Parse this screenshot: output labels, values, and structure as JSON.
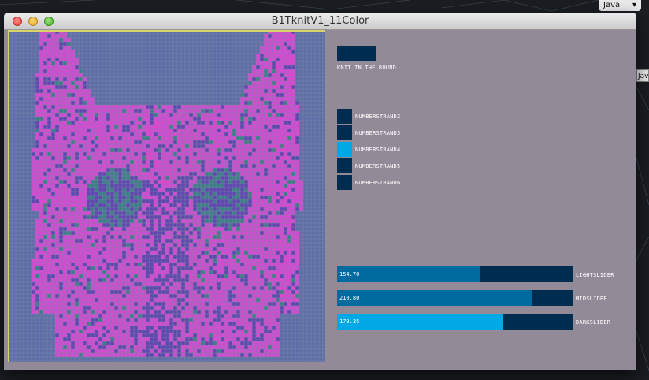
{
  "window": {
    "title": "B1TknitV1_11Color"
  },
  "external": {
    "java_label": "Java",
    "java_label2": "Jav"
  },
  "toggle": {
    "label": "KNIT IN THE ROUND"
  },
  "strands": [
    {
      "label": "NUMBERSTRAND2",
      "active": false
    },
    {
      "label": "NUMBERSTRAND3",
      "active": false
    },
    {
      "label": "NUMBERSTRAND4",
      "active": true
    },
    {
      "label": "NUMBERSTRAND5",
      "active": false
    },
    {
      "label": "NUMBERSTRAND6",
      "active": false
    }
  ],
  "sliders": [
    {
      "label": "LIGHTSLIDER",
      "value_text": "154.70",
      "fraction": 0.607
    },
    {
      "label": "MIDSLIDER",
      "value_text": "210.80",
      "fraction": 0.827
    },
    {
      "label": "DARKSLIDER",
      "value_text": "179.35",
      "fraction": 0.703
    }
  ],
  "colors": {
    "pink": "#d04cd0",
    "purple": "#6048b0",
    "teal": "#3f7e88",
    "grid_line": "#7d86a4",
    "border": "#d9d36a",
    "dark": "#002d4f",
    "mid": "#016a9f",
    "light": "#00a8e6"
  }
}
